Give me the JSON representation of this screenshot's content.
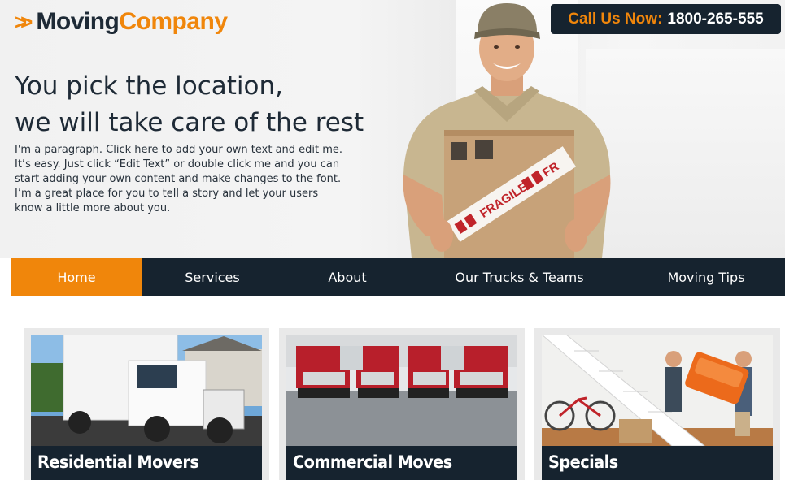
{
  "brand": {
    "word1": "Moving",
    "word2": "Company",
    "chevron": ">>"
  },
  "call": {
    "label": "Call Us Now:",
    "number": "1800-265-555"
  },
  "hero": {
    "headline_line1": "You pick the location,",
    "headline_line2": "we will take care of the rest",
    "paragraph": "I'm a paragraph. Click here to add your own text and edit me. It’s easy. Just click “Edit Text” or double click me and you can start adding your own content and make changes to the font. I’m a great place for you to tell a story and let your users know a little more about you.",
    "box_tape_text": "FRAGILE",
    "box_tape_text2": "FR"
  },
  "nav": {
    "items": [
      {
        "label": "Home",
        "active": true
      },
      {
        "label": "Services",
        "active": false
      },
      {
        "label": "About",
        "active": false
      },
      {
        "label": "Our Trucks & Teams",
        "active": false
      },
      {
        "label": "Moving Tips",
        "active": false
      }
    ]
  },
  "cards": [
    {
      "title": "Residential Movers",
      "image": "white-box-truck-photo"
    },
    {
      "title": "Commercial Moves",
      "image": "red-semi-trucks-photo"
    },
    {
      "title": "Specials",
      "image": "movers-carrying-sofa-photo"
    }
  ],
  "colors": {
    "accent": "#f0860b",
    "navy": "#16232f",
    "text": "#1e2a36"
  }
}
